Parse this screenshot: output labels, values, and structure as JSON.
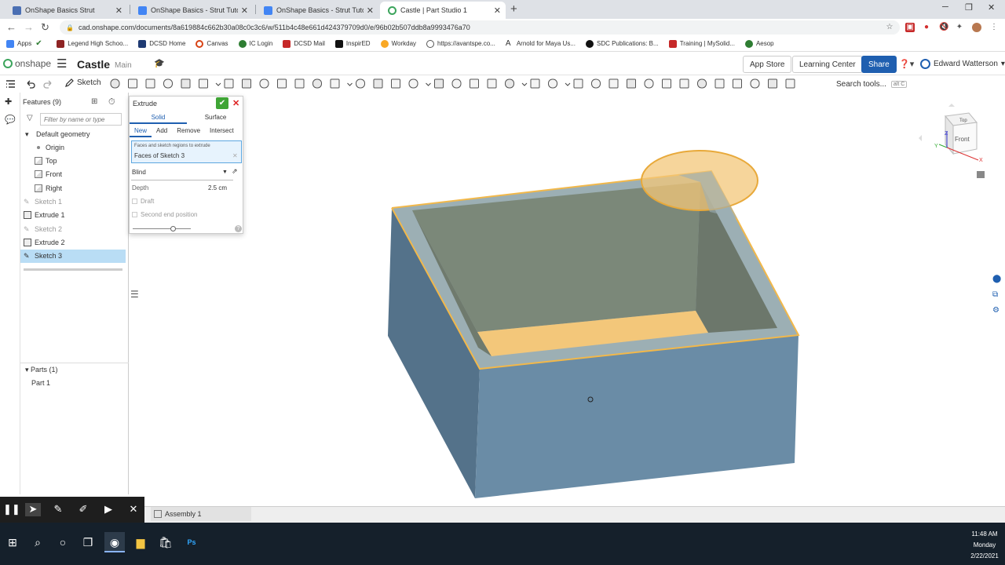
{
  "browser": {
    "tabs": [
      {
        "label": "OnShape Basics Strut",
        "active": false
      },
      {
        "label": "OnShape Basics - Strut Tutorial -",
        "active": false
      },
      {
        "label": "OnShape Basics - Strut Tutorial -",
        "active": false
      },
      {
        "label": "Castle | Part Studio 1",
        "active": true
      }
    ],
    "new_tab": "+",
    "url": "cad.onshape.com/documents/8a619884c662b30a08c0c3c6/w/511b4c48e661d424379709d0/e/96b02b507ddb8a9993476a70",
    "bookmarks": [
      "Apps",
      "",
      "Legend High Schoo...",
      "DCSD Home",
      "Canvas",
      "IC Login",
      "DCSD Mail",
      "InspirED",
      "Workday",
      "https://avantspe.co...",
      "Arnold for Maya Us...",
      "SDC Publications: B...",
      "Training | MySolid...",
      "Aesop"
    ]
  },
  "onshape": {
    "logo_text": "onshape",
    "doc_title": "Castle",
    "branch": "Main",
    "app_store": "App Store",
    "learning_center": "Learning Center",
    "share": "Share",
    "user_name": "Edward Watterson"
  },
  "toolbar": {
    "sketch_label": "Sketch",
    "search_placeholder": "Search tools...",
    "search_shortcut": "alt C"
  },
  "features": {
    "header": "Features (9)",
    "filter_placeholder": "Filter by name or type",
    "items": [
      {
        "label": "Default geometry",
        "kind": "folder",
        "state": "normal"
      },
      {
        "label": "Origin",
        "kind": "origin",
        "state": "normal"
      },
      {
        "label": "Top",
        "kind": "plane",
        "state": "normal"
      },
      {
        "label": "Front",
        "kind": "plane",
        "state": "normal"
      },
      {
        "label": "Right",
        "kind": "plane",
        "state": "normal"
      },
      {
        "label": "Sketch 1",
        "kind": "sketch",
        "state": "dim"
      },
      {
        "label": "Extrude 1",
        "kind": "extrude",
        "state": "normal"
      },
      {
        "label": "Sketch 2",
        "kind": "sketch",
        "state": "dim"
      },
      {
        "label": "Extrude 2",
        "kind": "extrude",
        "state": "normal"
      },
      {
        "label": "Sketch 3",
        "kind": "sketch",
        "state": "selected"
      }
    ],
    "parts_header": "Parts (1)",
    "parts": [
      "Part 1"
    ]
  },
  "extrude_dialog": {
    "title": "Extrude",
    "types": [
      "Solid",
      "Surface"
    ],
    "active_type": "Solid",
    "operations": [
      "New",
      "Add",
      "Remove",
      "Intersect"
    ],
    "active_operation": "New",
    "faces_hint": "Faces and sketch regions to extrude",
    "faces_value": "Faces of Sketch 3",
    "end_type": "Blind",
    "depth_label": "Depth",
    "depth_value": "2.5 cm",
    "draft_label": "Draft",
    "second_end_label": "Second end position",
    "slider_fraction": 0.7
  },
  "viewcube": {
    "top": "Top",
    "front": "Front",
    "axes": [
      "X",
      "Y",
      "Z"
    ]
  },
  "bottom": {
    "tabs": [
      "Assembly 1"
    ]
  },
  "taskbar": {
    "time": "11:48 AM",
    "day": "Monday",
    "date": "2/22/2021"
  },
  "colors": {
    "onshape_blue": "#1f5fb0",
    "confirm_green": "#3fa535",
    "selection_orange": "#f2b84a",
    "model_side": "#5b7a93",
    "model_front": "#6b8da7",
    "model_rim": "#9bb0b5",
    "model_inner": "#7f8a7a",
    "sketch_fill": "#f3c77a"
  }
}
